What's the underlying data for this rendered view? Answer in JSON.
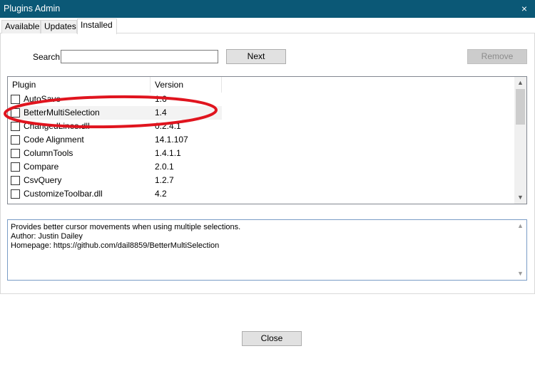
{
  "window": {
    "title": "Plugins Admin",
    "close_glyph": "×"
  },
  "tabs": [
    {
      "label": "Available",
      "active": false
    },
    {
      "label": "Updates",
      "active": false
    },
    {
      "label": "Installed",
      "active": true
    }
  ],
  "search": {
    "label": "Search:",
    "value": ""
  },
  "buttons": {
    "next": "Next",
    "remove": "Remove",
    "close": "Close"
  },
  "list": {
    "columns": [
      "Plugin",
      "Version"
    ],
    "rows": [
      {
        "name": "AutoSave",
        "version": "1.6",
        "checked": false
      },
      {
        "name": "BetterMultiSelection",
        "version": "1.4",
        "checked": false
      },
      {
        "name": "ChangedLines.dll",
        "version": "0.2.4.1",
        "checked": false
      },
      {
        "name": "Code Alignment",
        "version": "14.1.107",
        "checked": false
      },
      {
        "name": "ColumnTools",
        "version": "1.4.1.1",
        "checked": false
      },
      {
        "name": "Compare",
        "version": "2.0.1",
        "checked": false
      },
      {
        "name": "CsvQuery",
        "version": "1.2.7",
        "checked": false
      },
      {
        "name": "CustomizeToolbar.dll",
        "version": "4.2",
        "checked": false
      }
    ]
  },
  "description": {
    "lines": [
      "Provides better cursor movements when using multiple selections.",
      "Author: Justin Dailey",
      "Homepage: https://github.com/dail8859/BetterMultiSelection"
    ]
  },
  "icons": {
    "scroll_up": "▲",
    "scroll_down": "▼"
  },
  "colors": {
    "titlebar": "#0b5876",
    "annotation": "#e0141e",
    "row_highlight": "#f3f3f3"
  }
}
